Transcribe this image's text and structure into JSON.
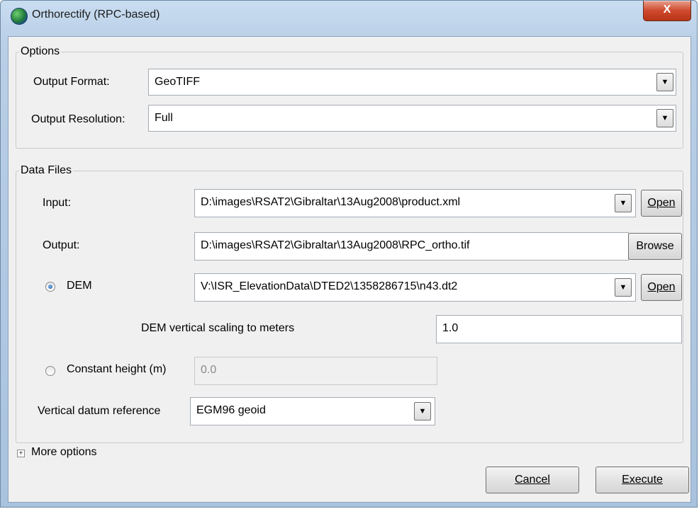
{
  "window": {
    "title": "Orthorectify (RPC-based)",
    "icon": "globe-icon",
    "close_label": "X"
  },
  "options": {
    "legend": "Options",
    "output_format": {
      "label": "Output Format:",
      "value": "GeoTIFF"
    },
    "output_resolution": {
      "label": "Output Resolution:",
      "value": "Full"
    }
  },
  "data_files": {
    "legend": "Data Files",
    "input": {
      "label": "Input:",
      "value": "D:\\images\\RSAT2\\Gibraltar\\13Aug2008\\product.xml",
      "button": "Open"
    },
    "output": {
      "label": "Output:",
      "value": "D:\\images\\RSAT2\\Gibraltar\\13Aug2008\\RPC_ortho.tif",
      "button": "Browse"
    },
    "dem": {
      "label": "DEM",
      "value": "V:\\ISR_ElevationData\\DTED2\\1358286715\\n43.dt2",
      "button": "Open",
      "selected": true
    },
    "dem_scaling": {
      "label": "DEM vertical scaling to meters",
      "value": "1.0"
    },
    "constant_height": {
      "label": "Constant height (m)",
      "value": "0.0",
      "selected": false
    },
    "vertical_datum": {
      "label": "Vertical datum reference",
      "value": "EGM96 geoid"
    }
  },
  "more_options": {
    "label": "More options"
  },
  "footer": {
    "cancel": "Cancel",
    "execute": "Execute"
  }
}
